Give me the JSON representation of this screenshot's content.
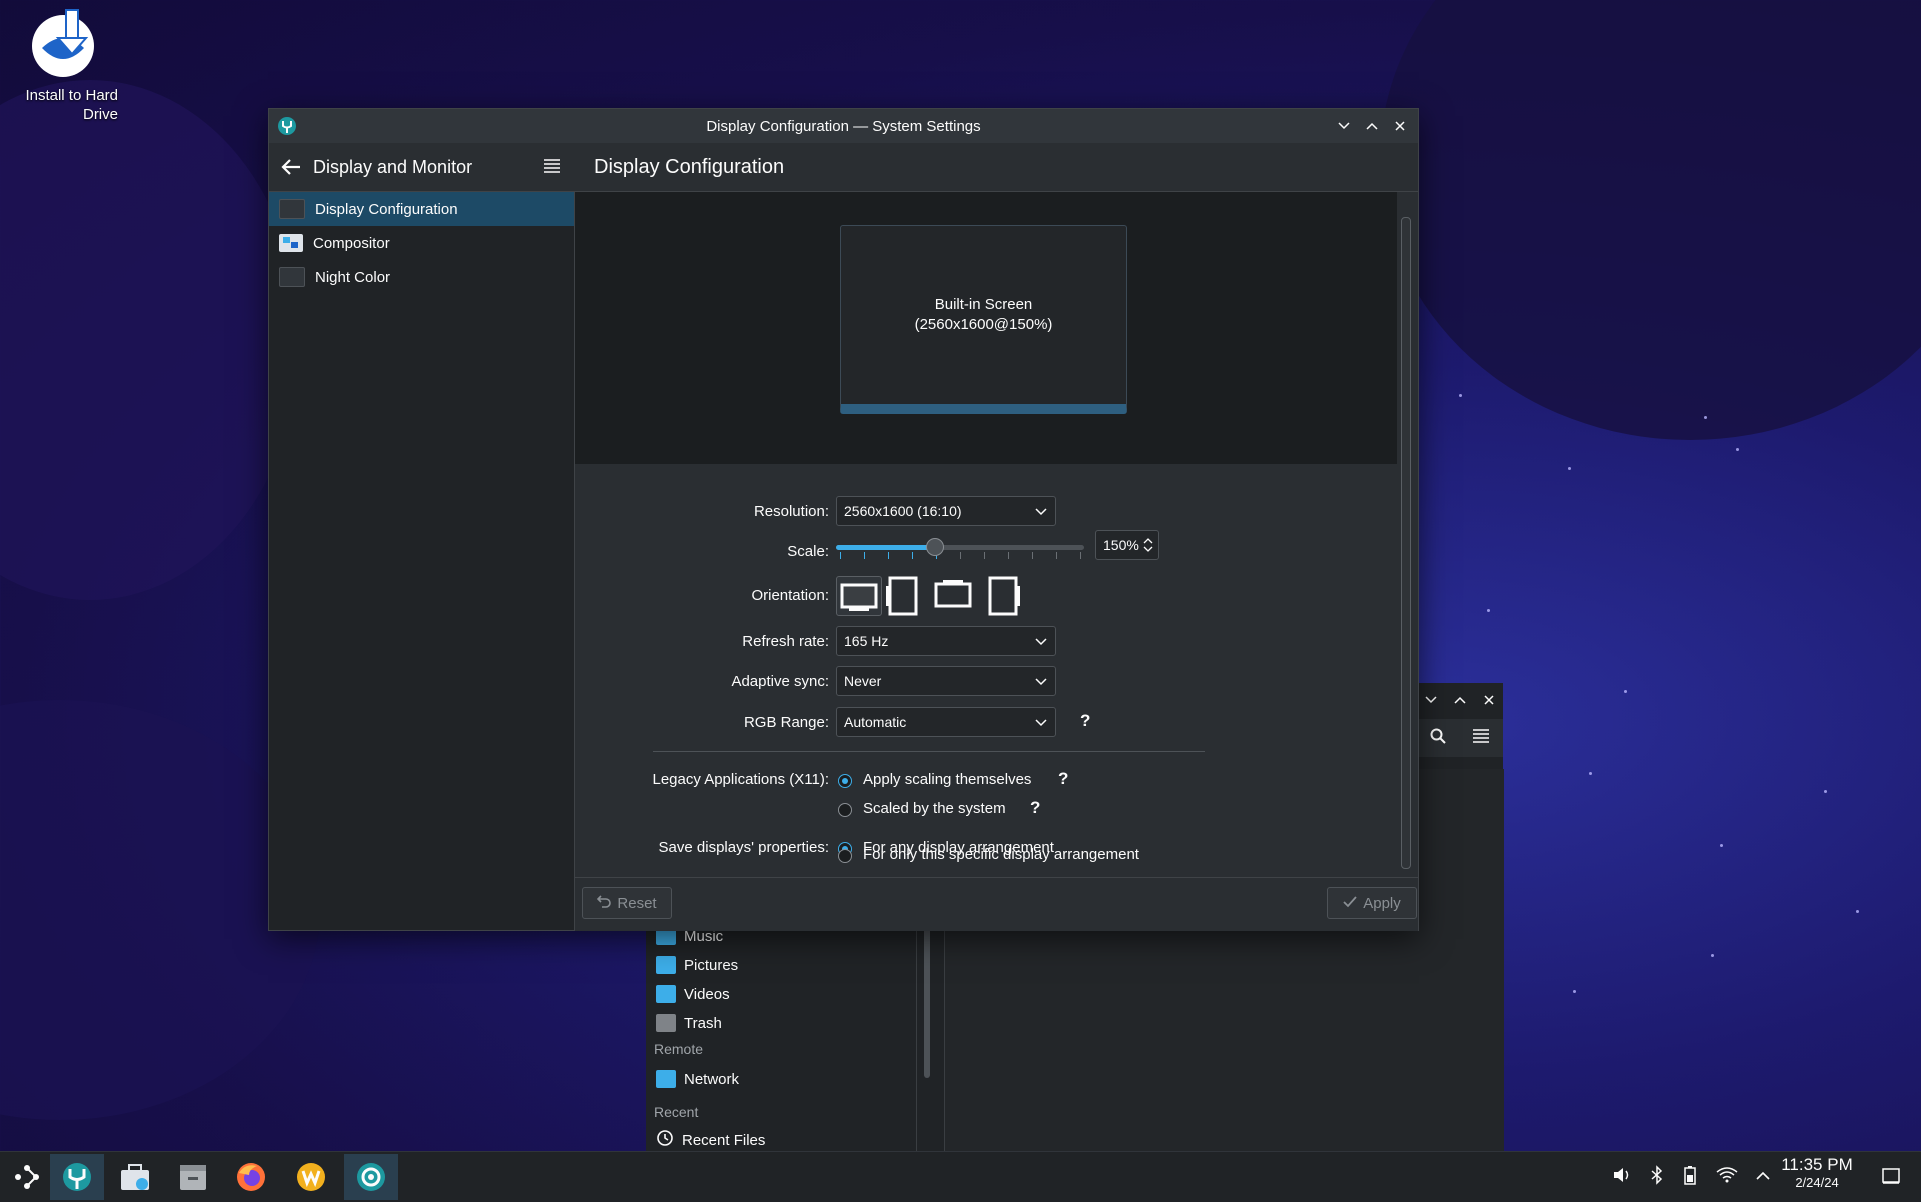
{
  "desktop": {
    "icon_label": "Install to Hard Drive",
    "icon_name": "install-icon"
  },
  "window": {
    "title": "Display Configuration — System Settings",
    "buttons": [
      "minimize-icon",
      "maximize-icon",
      "close-icon"
    ]
  },
  "sidebar": {
    "back_label": "Display and Monitor",
    "items": [
      {
        "label": "Display Configuration",
        "selected": true
      },
      {
        "label": "Compositor",
        "selected": false
      },
      {
        "label": "Night Color",
        "selected": false
      }
    ]
  },
  "content": {
    "title": "Display Configuration",
    "screen": {
      "name": "Built-in Screen",
      "mode": "(2560x1600@150%)"
    },
    "resolution": {
      "label": "Resolution:",
      "value": "2560x1600 (16:10)"
    },
    "scale": {
      "label": "Scale:",
      "value": "150%",
      "slider_fraction": 0.4
    },
    "orientation": {
      "label": "Orientation:",
      "options": [
        "landscape",
        "portrait-left",
        "landscape-flipped",
        "portrait-right"
      ]
    },
    "refresh": {
      "label": "Refresh rate:",
      "value": "165 Hz"
    },
    "adaptive": {
      "label": "Adaptive sync:",
      "value": "Never"
    },
    "rgb": {
      "label": "RGB Range:",
      "value": "Automatic",
      "help": "?"
    },
    "legacy": {
      "label": "Legacy Applications (X11):",
      "options": [
        {
          "label": "Apply scaling themselves",
          "checked": true,
          "help": "?"
        },
        {
          "label": "Scaled by the system",
          "checked": false,
          "help": "?"
        }
      ]
    },
    "save": {
      "label": "Save displays' properties:",
      "options": [
        {
          "label": "For any display arrangement",
          "checked": true
        },
        {
          "label": "For only this specific display arrangement",
          "checked": false
        }
      ]
    },
    "reset_label": "Reset",
    "apply_label": "Apply"
  },
  "file_manager": {
    "places": [
      "Music",
      "Pictures",
      "Videos",
      "Trash"
    ],
    "remote_header": "Remote",
    "remote_items": [
      "Network"
    ],
    "recent_header": "Recent",
    "recent_items": [
      "Recent Files"
    ]
  },
  "taskbar": {
    "apps": [
      "application-launcher-icon",
      "system-settings-icon",
      "discover-icon",
      "file-manager-icon",
      "firefox-icon",
      "wps-icon",
      "steam-capture-icon"
    ],
    "time": "11:35 PM",
    "date": "2/24/24"
  },
  "colors": {
    "accent": "#3daee9",
    "selection": "#1d4a66",
    "window_bg": "#2a2e32"
  }
}
